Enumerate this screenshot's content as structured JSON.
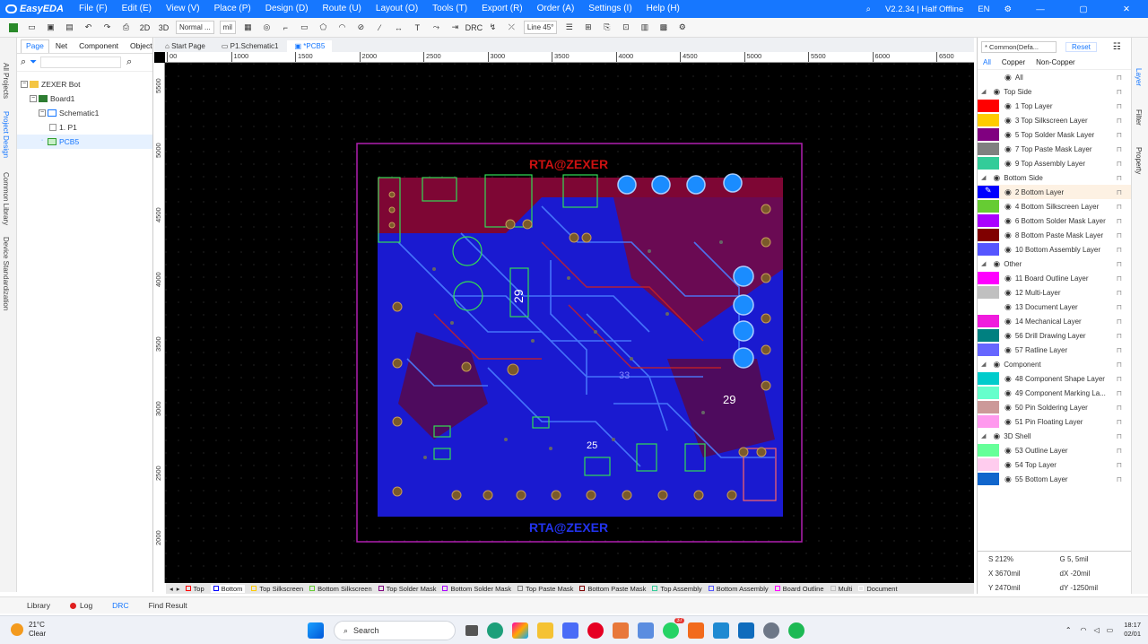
{
  "app": {
    "name": "EasyEDA",
    "version": "V2.2.34 | Half Offline",
    "lang": "EN"
  },
  "menu": [
    "File (F)",
    "Edit (E)",
    "View (V)",
    "Place (P)",
    "Design (D)",
    "Route (U)",
    "Layout (O)",
    "Tools (T)",
    "Export (R)",
    "Order (A)",
    "Settings (I)",
    "Help (H)"
  ],
  "toolbar": {
    "mode": "Normal ...",
    "unit": "mil",
    "line_angle": "Line 45°",
    "btn_2d": "2D",
    "btn_3d": "3D",
    "drc_label": "DRC"
  },
  "left_vertical_tabs": [
    "All Projects",
    "Project Design",
    "Common Library",
    "Device Standardization"
  ],
  "left_panel": {
    "tabs": [
      "Page",
      "Net",
      "Component",
      "Object"
    ],
    "tree": [
      {
        "label": "ZEXER Bot",
        "level": 0
      },
      {
        "label": "Board1",
        "level": 1
      },
      {
        "label": "Schematic1",
        "level": 2
      },
      {
        "label": "1. P1",
        "level": 3
      },
      {
        "label": "PCB5",
        "level": 2,
        "selected": true
      }
    ]
  },
  "doc_tabs": [
    "Start Page",
    "P1.Schematic1",
    "*PCB5"
  ],
  "ruler": {
    "top": [
      "00",
      "1000",
      "1500",
      "2000",
      "2500",
      "3000",
      "3500",
      "4000",
      "4500",
      "5000",
      "5500",
      "6000",
      "6500"
    ],
    "left": [
      "5500",
      "5000",
      "4500",
      "4000",
      "3500",
      "3000",
      "2500",
      "2000"
    ]
  },
  "board": {
    "silk_title": "RTA@ZEXER",
    "silk_title_bottom": "RTA@ZEXER",
    "big_label_1": "29",
    "big_label_2": "29",
    "big_label_3": "25",
    "label_33": "33"
  },
  "layer_bar": [
    {
      "label": "Top",
      "color": "#ff0000"
    },
    {
      "label": "Bottom",
      "color": "#0000ff",
      "active": true
    },
    {
      "label": "Top Silkscreen",
      "color": "#ffcc00"
    },
    {
      "label": "Bottom Silkscreen",
      "color": "#66cc33"
    },
    {
      "label": "Top Solder Mask",
      "color": "#800080"
    },
    {
      "label": "Bottom Solder Mask",
      "color": "#aa00ff"
    },
    {
      "label": "Top Paste Mask",
      "color": "#808080"
    },
    {
      "label": "Bottom Paste Mask",
      "color": "#800000"
    },
    {
      "label": "Top Assembly",
      "color": "#33cc99"
    },
    {
      "label": "Bottom Assembly",
      "color": "#5555ff"
    },
    {
      "label": "Board Outline",
      "color": "#ff00ff"
    },
    {
      "label": "Multi",
      "color": "#c0c0c0"
    },
    {
      "label": "Document",
      "color": "#ffffff"
    }
  ],
  "right_panel": {
    "preset": "* Common(Defa...",
    "reset": "Reset",
    "filters": [
      "All",
      "Copper",
      "Non-Copper"
    ],
    "all_label": "All",
    "groups": [
      {
        "title": "Top Side",
        "layers": [
          {
            "name": "1 Top Layer",
            "color": "#ff0000"
          },
          {
            "name": "3 Top Silkscreen Layer",
            "color": "#ffcc00"
          },
          {
            "name": "5 Top Solder Mask Layer",
            "color": "#800080"
          },
          {
            "name": "7 Top Paste Mask Layer",
            "color": "#808080"
          },
          {
            "name": "9 Top Assembly Layer",
            "color": "#33cc99"
          }
        ]
      },
      {
        "title": "Bottom Side",
        "layers": [
          {
            "name": "2 Bottom Layer",
            "color": "#0000ff",
            "active": true
          },
          {
            "name": "4 Bottom Silkscreen Layer",
            "color": "#66cc33"
          },
          {
            "name": "6 Bottom Solder Mask Layer",
            "color": "#aa00ff"
          },
          {
            "name": "8 Bottom Paste Mask Layer",
            "color": "#800000"
          },
          {
            "name": "10 Bottom Assembly Layer",
            "color": "#5555ff"
          }
        ]
      },
      {
        "title": "Other",
        "layers": [
          {
            "name": "11 Board Outline Layer",
            "color": "#ff00ff"
          },
          {
            "name": "12 Multi-Layer",
            "color": "#c0c0c0"
          },
          {
            "name": "13 Document Layer",
            "color": "#ffffff"
          },
          {
            "name": "14 Mechanical Layer",
            "color": "#f01cdd"
          },
          {
            "name": "56 Drill Drawing Layer",
            "color": "#008080"
          },
          {
            "name": "57 Ratline Layer",
            "color": "#6666ff"
          }
        ]
      },
      {
        "title": "Component",
        "layers": [
          {
            "name": "48 Component Shape Layer",
            "color": "#00cccc"
          },
          {
            "name": "49 Component Marking La...",
            "color": "#66ffcc"
          },
          {
            "name": "50 Pin Soldering Layer",
            "color": "#cc9999"
          },
          {
            "name": "51 Pin Floating Layer",
            "color": "#ff99ee"
          }
        ]
      },
      {
        "title": "3D Shell",
        "layers": [
          {
            "name": "53 Outline Layer",
            "color": "#66ff99"
          },
          {
            "name": "54 Top Layer",
            "color": "#ffccee"
          },
          {
            "name": "55 Bottom Layer",
            "color": "#1166cc"
          }
        ]
      }
    ]
  },
  "right_vertical_tabs": [
    "Layer",
    "Filter",
    "Property"
  ],
  "coords": {
    "s": "S  212%",
    "g": "G  5, 5mil",
    "x": "X  3670mil",
    "dx": "dX  -20mil",
    "y": "Y  2470mil",
    "dy": "dY  -1250mil"
  },
  "bottom_tabs": [
    "Library",
    "Log",
    "DRC",
    "Find Result"
  ],
  "taskbar": {
    "temp": "21°C",
    "weather": "Clear",
    "search": "Search",
    "time": "18:17",
    "date": "02/01",
    "badge": "37"
  }
}
